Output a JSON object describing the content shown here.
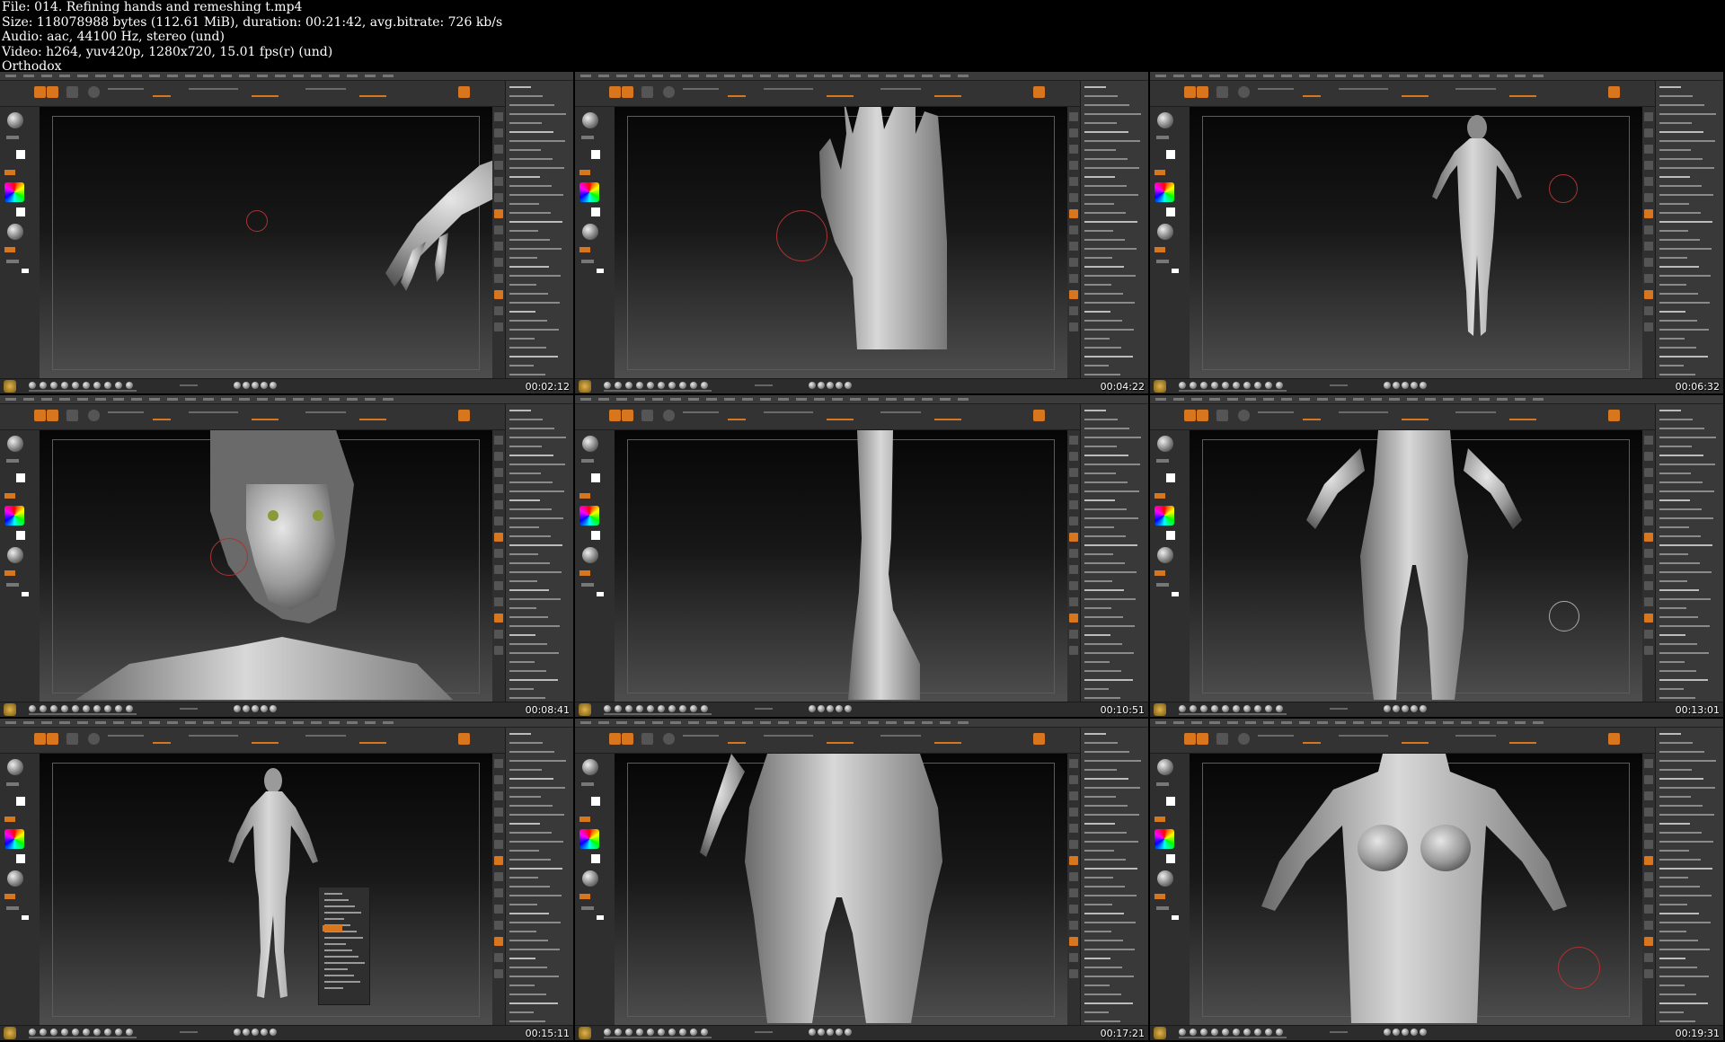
{
  "file_info": {
    "file": "File: 014. Refining hands and remeshing t.mp4",
    "size": "Size: 118078988 bytes (112.61 MiB), duration: 00:21:42, avg.bitrate: 726 kb/s",
    "audio": "Audio: aac, 44100 Hz, stereo (und)",
    "video": "Video: h264, yuv420p, 1280x720, 15.01 fps(r) (und)",
    "uploader": "Orthodox"
  },
  "thumbnails": [
    {
      "timestamp": "00:02:12",
      "subject": "hand-side-view"
    },
    {
      "timestamp": "00:04:22",
      "subject": "hand-palm-view"
    },
    {
      "timestamp": "00:06:32",
      "subject": "full-body-front"
    },
    {
      "timestamp": "00:08:41",
      "subject": "face-closeup"
    },
    {
      "timestamp": "00:10:51",
      "subject": "ankle-closeup"
    },
    {
      "timestamp": "00:13:01",
      "subject": "torso-legs-front"
    },
    {
      "timestamp": "00:15:11",
      "subject": "full-body-with-menu"
    },
    {
      "timestamp": "00:17:21",
      "subject": "back-view-closeup"
    },
    {
      "timestamp": "00:19:31",
      "subject": "torso-front-closeup"
    }
  ],
  "colors": {
    "ui_accent": "#d8761e",
    "ui_background": "#2a2a2a",
    "model_matcap": "#c8c8c8",
    "brush_ring": "#aa3333"
  }
}
